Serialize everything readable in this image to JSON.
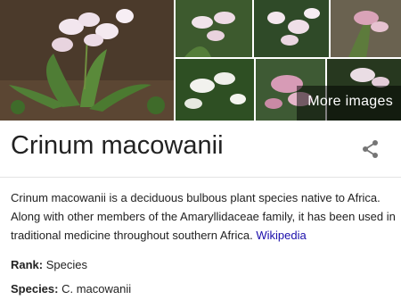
{
  "gallery": {
    "more_label": "More images",
    "tiles": [
      {
        "name": "main-photo",
        "bg": "#4a3a2c"
      },
      {
        "name": "thumb-1",
        "bg": "#3d5a2e"
      },
      {
        "name": "thumb-2",
        "bg": "#2f4a28"
      },
      {
        "name": "thumb-3",
        "bg": "#6a6250"
      },
      {
        "name": "thumb-4",
        "bg": "#2e4f23"
      },
      {
        "name": "thumb-5",
        "bg": "#3e5a34"
      },
      {
        "name": "thumb-6",
        "bg": "#27381f"
      }
    ]
  },
  "entity": {
    "title": "Crinum macowanii",
    "description": "Crinum macowanii is a deciduous bulbous plant species native to Africa. Along with other members of the Amaryllidaceae family, it has been used in traditional medicine throughout southern Africa.",
    "source_link": "Wikipedia",
    "facts": [
      {
        "label": "Rank:",
        "value": "Species"
      },
      {
        "label": "Species:",
        "value": "C. macowanii"
      }
    ]
  },
  "colors": {
    "link": "#1a0dab",
    "text": "#222222",
    "share_icon": "#757575"
  }
}
